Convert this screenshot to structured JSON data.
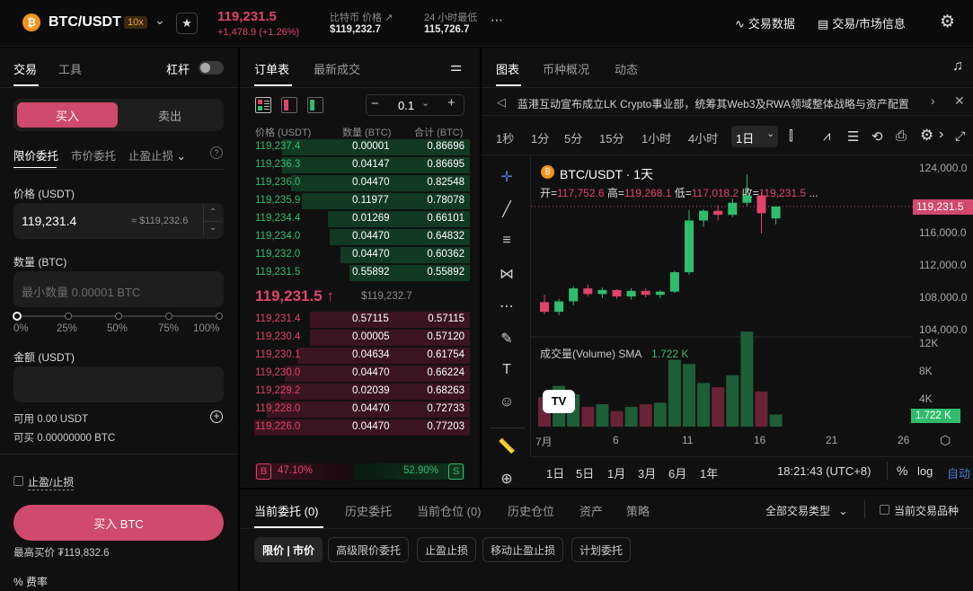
{
  "header": {
    "pair": "BTC/USDT",
    "leverage": "10x",
    "last_price": "119,231.5",
    "change": "+1,478.9 (+1.26%)",
    "index_label": "比特币 价格",
    "index_value": "$119,232.7",
    "low_label": "24 小时最低",
    "low_value": "115,726.7",
    "more": "⋯",
    "trade_data": "交易数据",
    "market_info": "交易/市场信息"
  },
  "form": {
    "tab_trade": "交易",
    "tab_tools": "工具",
    "leverage_label": "杠杆",
    "buy": "买入",
    "sell": "卖出",
    "type_limit": "限价委托",
    "type_market": "市价委托",
    "type_stop": "止盈止损",
    "price_label": "价格 (USDT)",
    "price_value": "119,231.4",
    "price_usd": "≈ $119,232.6",
    "qty_label": "数量 (BTC)",
    "qty_placeholder": "最小数量 0.00001 BTC",
    "pct": [
      "0%",
      "25%",
      "50%",
      "75%",
      "100%"
    ],
    "amount_label": "金额 (USDT)",
    "available": "可用 0.00 USDT",
    "can_buy": "可买 0.00000000 BTC",
    "tp_sl": "止盈/止损",
    "submit": "买入 BTC",
    "max_buy": "最高买价 ₮119,832.6",
    "fee": "费率",
    "fee_icon": "%"
  },
  "orderbook": {
    "tab_book": "订单表",
    "tab_trades": "最新成交",
    "step": "0.1",
    "col_price": "价格 (USDT)",
    "col_qty": "数量 (BTC)",
    "col_total": "合计 (BTC)",
    "bids": [
      {
        "p": "119,237.4",
        "q": "0.00001",
        "t": "0.86696",
        "d": 0.87
      },
      {
        "p": "119,236.3",
        "q": "0.04147",
        "t": "0.86695",
        "d": 0.87
      },
      {
        "p": "119,236.0",
        "q": "0.04470",
        "t": "0.82548",
        "d": 0.83
      },
      {
        "p": "119,235.9",
        "q": "0.11977",
        "t": "0.78078",
        "d": 0.78
      },
      {
        "p": "119,234.4",
        "q": "0.01269",
        "t": "0.66101",
        "d": 0.66
      },
      {
        "p": "119,234.0",
        "q": "0.04470",
        "t": "0.64832",
        "d": 0.65
      },
      {
        "p": "119,232.0",
        "q": "0.04470",
        "t": "0.60362",
        "d": 0.6
      },
      {
        "p": "119,231.5",
        "q": "0.55892",
        "t": "0.55892",
        "d": 0.56
      }
    ],
    "mid_price": "119,231.5",
    "mid_arrow": "↑",
    "mid_usd": "$119,232.7",
    "asks": [
      {
        "p": "119,231.4",
        "q": "0.57115",
        "t": "0.57115",
        "d": 0.74
      },
      {
        "p": "119,230.4",
        "q": "0.00005",
        "t": "0.57120",
        "d": 0.74
      },
      {
        "p": "119,230.1",
        "q": "0.04634",
        "t": "0.61754",
        "d": 0.8
      },
      {
        "p": "119,230.0",
        "q": "0.04470",
        "t": "0.66224",
        "d": 0.86
      },
      {
        "p": "119,229.2",
        "q": "0.02039",
        "t": "0.68263",
        "d": 0.88
      },
      {
        "p": "119,228.0",
        "q": "0.04470",
        "t": "0.72733",
        "d": 0.94
      },
      {
        "p": "119,226.0",
        "q": "0.04470",
        "t": "0.77203",
        "d": 1.0
      }
    ],
    "buy_letter": "B",
    "buy_pct": "47.10%",
    "sell_pct": "52.90%",
    "sell_letter": "S"
  },
  "chart": {
    "tab_chart": "图表",
    "tab_overview": "币种概况",
    "tab_news": "动态",
    "news": "蓝港互动宣布成立LK Crypto事业部，统筹其Web3及RWA领域整体战略与资产配置",
    "timeframes": [
      "1秒",
      "1分",
      "5分",
      "15分",
      "1小时",
      "4小时",
      "1日"
    ],
    "symbol": "BTC/USDT · 1天",
    "ohlc": {
      "o_label": "开=",
      "o": "117,752.6",
      "h_label": "高=",
      "h": "119,268.1",
      "l_label": "低=",
      "l": "117,018.2",
      "c_label": "收=",
      "c": "119,231.5",
      "more": "..."
    },
    "price_tag": "119,231.5",
    "vol_tag": "1.722 K",
    "y_ticks": [
      "124,000.0",
      "116,000.0",
      "112,000.0",
      "108,000.0",
      "104,000.0"
    ],
    "vol_label": "成交量(Volume)",
    "vol_sma": "SMA",
    "vol_value": "1.722 K",
    "vol_ticks": [
      "12K",
      "8K",
      "4K"
    ],
    "x_ticks": [
      "7月",
      "6",
      "11",
      "16",
      "21",
      "26"
    ],
    "ranges": [
      "1日",
      "5日",
      "1月",
      "3月",
      "6月",
      "1年"
    ],
    "clock": "18:21:43 (UTC+8)",
    "pct_btn": "%",
    "log_btn": "log",
    "auto_btn": "自动",
    "candles": [
      {
        "o": 107400,
        "h": 108300,
        "l": 105900,
        "c": 106200
      },
      {
        "o": 106200,
        "h": 107800,
        "l": 105800,
        "c": 107500
      },
      {
        "o": 107500,
        "h": 109400,
        "l": 107000,
        "c": 109100
      },
      {
        "o": 109100,
        "h": 109600,
        "l": 108100,
        "c": 108400
      },
      {
        "o": 108400,
        "h": 109200,
        "l": 107900,
        "c": 108900
      },
      {
        "o": 108900,
        "h": 109000,
        "l": 107800,
        "c": 108100
      },
      {
        "o": 108100,
        "h": 109100,
        "l": 107700,
        "c": 108800
      },
      {
        "o": 108800,
        "h": 109100,
        "l": 108000,
        "c": 108300
      },
      {
        "o": 108300,
        "h": 108900,
        "l": 107900,
        "c": 108700
      },
      {
        "o": 108700,
        "h": 111300,
        "l": 108500,
        "c": 111100
      },
      {
        "o": 111100,
        "h": 118800,
        "l": 110800,
        "c": 117500
      },
      {
        "o": 117500,
        "h": 118900,
        "l": 116700,
        "c": 118700
      },
      {
        "o": 118700,
        "h": 119400,
        "l": 117500,
        "c": 118200
      },
      {
        "o": 118200,
        "h": 120200,
        "l": 117900,
        "c": 119700
      },
      {
        "o": 119700,
        "h": 123200,
        "l": 119300,
        "c": 120600
      },
      {
        "o": 120600,
        "h": 121000,
        "l": 115900,
        "c": 118400
      },
      {
        "o": 117752.6,
        "h": 119268.1,
        "l": 117018.2,
        "c": 119231.5
      }
    ],
    "volumes": [
      4200,
      5800,
      4600,
      2800,
      3200,
      2200,
      2800,
      3200,
      3400,
      9500,
      8900,
      6200,
      5600,
      7300,
      13500,
      5000,
      1722
    ]
  },
  "bottom": {
    "tabs": [
      "当前委托 (0)",
      "历史委托",
      "当前仓位 (0)",
      "历史仓位",
      "资产",
      "策略"
    ],
    "filter": "全部交易类型",
    "current_pair": "当前交易品种",
    "chips": [
      "限价 | 市价",
      "高级限价委托",
      "止盈止损",
      "移动止盈止损",
      "计划委托"
    ]
  },
  "colors": {
    "up": "#2fbd6d",
    "down": "#e0436a"
  }
}
